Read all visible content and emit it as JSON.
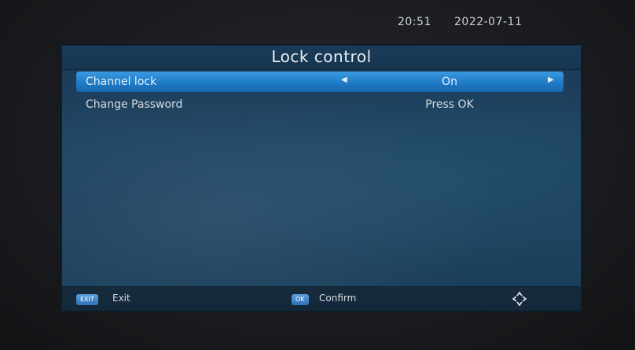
{
  "status_bar": {
    "time": "20:51",
    "date": "2022-07-11"
  },
  "panel": {
    "title": "Lock control"
  },
  "menu": {
    "items": [
      {
        "label": "Channel lock",
        "value": "On",
        "selected": true
      },
      {
        "label": "Change Password",
        "value": "Press OK",
        "selected": false
      }
    ]
  },
  "footer": {
    "exit_key": "EXIT",
    "exit_label": "Exit",
    "ok_key": "OK",
    "ok_label": "Confirm",
    "nav_icon": "navigation-arrows-icon"
  },
  "colors": {
    "highlight": "#1f7bc6",
    "panel_background": "#1e4461",
    "key_badge": "#2f72b5"
  }
}
